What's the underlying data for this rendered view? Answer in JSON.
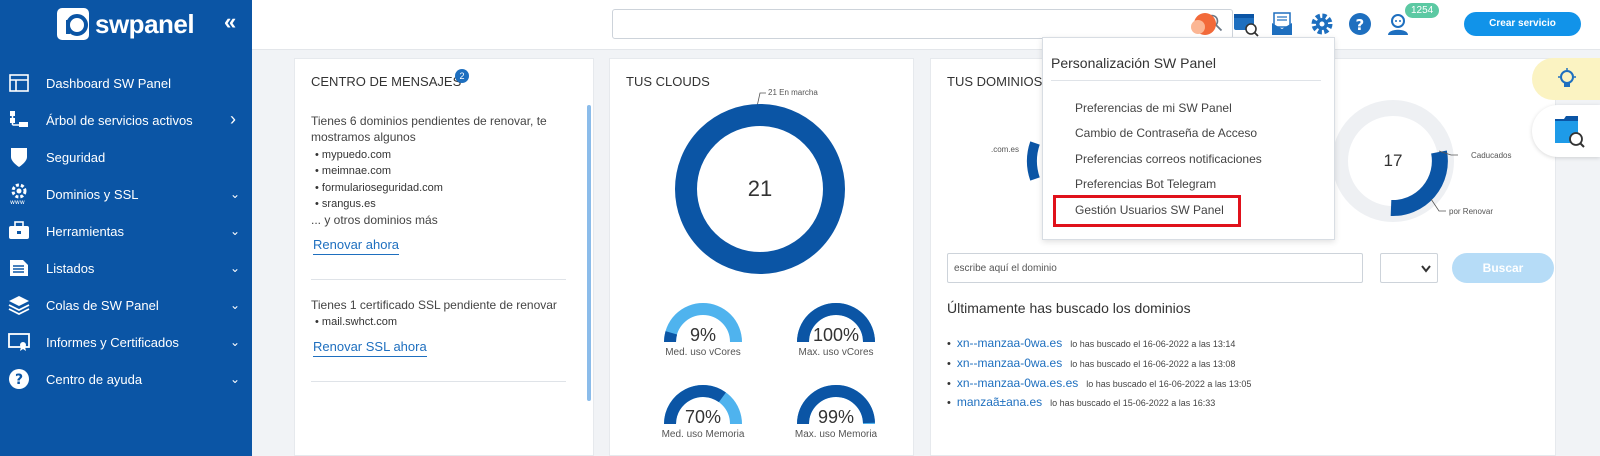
{
  "brand": {
    "name": "swpanel"
  },
  "sidebar": {
    "collapse_glyph": "«",
    "items": [
      {
        "label": "Dashboard SW Panel",
        "icon": "dashboard-icon",
        "chevron": ""
      },
      {
        "label": "Árbol de servicios activos",
        "icon": "tree-icon",
        "chevron": "›"
      },
      {
        "label": "Seguridad",
        "icon": "shield-icon",
        "chevron": ""
      },
      {
        "label": "Dominios y SSL",
        "icon": "domain-gear-icon",
        "chevron": "⌄"
      },
      {
        "label": "Herramientas",
        "icon": "toolbox-icon",
        "chevron": "⌄"
      },
      {
        "label": "Listados",
        "icon": "list-icon",
        "chevron": "⌄"
      },
      {
        "label": "Colas de SW Panel",
        "icon": "layers-icon",
        "chevron": "⌄"
      },
      {
        "label": "Informes y Certificados",
        "icon": "certificate-icon",
        "chevron": "⌄"
      },
      {
        "label": "Centro de ayuda",
        "icon": "help-icon",
        "chevron": "⌄"
      }
    ]
  },
  "header": {
    "search_value": "",
    "notification_count": "1254",
    "create_button": "Crear servicio"
  },
  "messages": {
    "title": "CENTRO DE MENSAJES",
    "badge": "2",
    "domains_text_line1": "Tienes 6 dominios pendientes de renovar, te",
    "domains_text_line2": "mostramos algunos",
    "domains": [
      "• mypuedo.com",
      "• meimnae.com",
      "• formularioseguridad.com",
      "• srangus.es"
    ],
    "more": "... y otros dominios más",
    "renew_link": "Renovar ahora",
    "ssl_text": "Tienes 1 certificado SSL pendiente de renovar",
    "ssl_domains": [
      "• mail.swhct.com"
    ],
    "ssl_link": "Renovar SSL ahora"
  },
  "clouds": {
    "title": "TUS CLOUDS",
    "total": "21",
    "running_label": "21 En marcha",
    "gauges": [
      {
        "value": "9%",
        "label": "Med. uso vCores",
        "fill": 0.09
      },
      {
        "value": "100%",
        "label": "Max. uso vCores",
        "fill": 1.0
      },
      {
        "value": "70%",
        "label": "Med. uso Memoria",
        "fill": 0.7
      },
      {
        "value": "99%",
        "label": "Max. uso Memoria",
        "fill": 0.99
      }
    ]
  },
  "domains_card": {
    "title": "TUS DOMINIOS",
    "tld_label": ".com.es",
    "total": "17",
    "expired_label": "Caducados",
    "renew_label": "por Renovar",
    "search_placeholder": "escribe aquí el dominio",
    "search_button": "Buscar",
    "recent_title": "Últimamente has buscado los dominios",
    "recent": [
      {
        "name": "xn--manzaa-0wa.es",
        "date": "lo has buscado el 16-06-2022 a las 13:14"
      },
      {
        "name": "xn--manzaa-0wa.es",
        "date": "lo has buscado el 16-06-2022 a las 13:08"
      },
      {
        "name": "xn--manzaa-0wa.es.es",
        "date": "lo has buscado el 16-06-2022 a las 13:05"
      },
      {
        "name": "manzaã±ana.es",
        "date": "lo has buscado el 15-06-2022 a las 16:33"
      }
    ]
  },
  "dropdown": {
    "title": "Personalización SW Panel",
    "items": [
      "Preferencias de mi SW Panel",
      "Cambio de Contraseña de Acceso",
      "Preferencias correos notificaciones",
      "Preferencias Bot Telegram",
      "Gestión Usuarios SW Panel"
    ]
  },
  "colors": {
    "sidebar": "#0b55a5",
    "accent": "#1193e9",
    "donut": "#0b55a5",
    "gauge_light": "#4fb3ee",
    "highlight": "#e0111b"
  }
}
